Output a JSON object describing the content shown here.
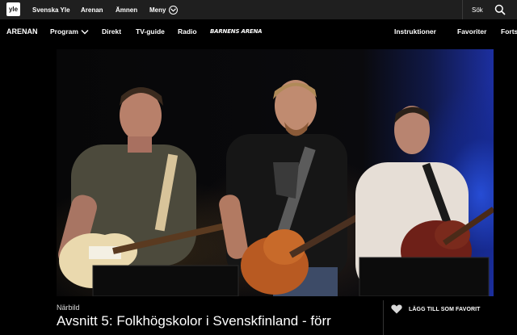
{
  "topbar": {
    "logo": "yle",
    "links": [
      "Svenska Yle",
      "Arenan",
      "Ämnen",
      "Meny"
    ],
    "search_label": "Sök"
  },
  "arena_nav": {
    "brand": "ARENAN",
    "items": [
      "Program",
      "Direkt",
      "TV-guide",
      "Radio",
      "BARNENS ARENA"
    ],
    "right_items": [
      "Instruktioner",
      "Favoriter",
      "Forts"
    ]
  },
  "video_info": {
    "category": "Närbild",
    "title": "Avsnitt 5: Folkhögskolor i Svenskfinland - förr",
    "favorite_label": "LÄGG TILL SOM FAVORIT"
  },
  "icons": {
    "menu": "chevron-down-circle-icon",
    "search": "search-icon",
    "program": "chevron-down-icon",
    "favorite": "heart-icon"
  }
}
